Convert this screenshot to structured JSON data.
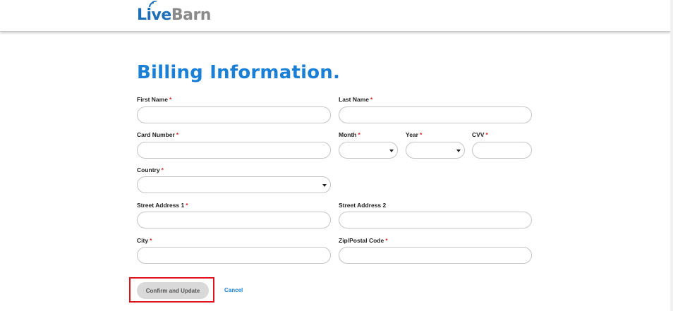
{
  "header": {
    "logo_part1": "Live",
    "logo_part2": "Barn"
  },
  "page": {
    "title": "Billing Information."
  },
  "form": {
    "first_name": {
      "label": "First Name",
      "required_mark": "*",
      "value": ""
    },
    "last_name": {
      "label": "Last Name",
      "required_mark": "*",
      "value": ""
    },
    "card_number": {
      "label": "Card Number",
      "required_mark": "*",
      "value": ""
    },
    "month": {
      "label": "Month",
      "required_mark": "*",
      "value": ""
    },
    "year": {
      "label": "Year",
      "required_mark": "*",
      "value": ""
    },
    "cvv": {
      "label": "CVV",
      "required_mark": "*",
      "value": ""
    },
    "country": {
      "label": "Country",
      "required_mark": "*",
      "value": ""
    },
    "street_address_1": {
      "label": "Street Address 1",
      "required_mark": "*",
      "value": ""
    },
    "street_address_2": {
      "label": "Street Address 2",
      "value": ""
    },
    "city": {
      "label": "City",
      "required_mark": "*",
      "value": ""
    },
    "zip": {
      "label": "Zip/Postal Code",
      "required_mark": "*",
      "value": ""
    }
  },
  "actions": {
    "confirm_label": "Confirm and Update",
    "cancel_label": "Cancel"
  },
  "colors": {
    "accent": "#1a7fd6",
    "required": "#d62828",
    "highlight": "#e0141e",
    "button_bg": "#d9d9d9"
  }
}
